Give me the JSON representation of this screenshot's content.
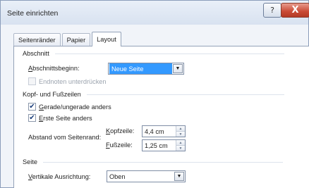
{
  "window": {
    "title": "Seite einrichten",
    "help_glyph": "?",
    "close_glyph": "X"
  },
  "tabs": [
    {
      "label": "Seitenränder",
      "active": false
    },
    {
      "label": "Papier",
      "active": false
    },
    {
      "label": "Layout",
      "active": true
    }
  ],
  "abschnitt": {
    "heading": "Abschnitt",
    "abschnittsbeginn_label": "Abschnittsbeginn:",
    "abschnittsbeginn_value": "Neue Seite",
    "endnoten_label": "Endnoten unterdrücken",
    "endnoten_checked": false
  },
  "kopf_fuss": {
    "heading": "Kopf- und Fußzeilen",
    "gerade_label": "Gerade/ungerade anders",
    "gerade_checked": true,
    "erste_label": "Erste Seite anders",
    "erste_checked": true,
    "abstand_label": "Abstand vom Seitenrand:",
    "kopfzeile_label": "Kopfzeile:",
    "kopfzeile_value": "4,4 cm",
    "fusszeile_label": "Fußzeile:",
    "fusszeile_value": "1,25 cm"
  },
  "seite": {
    "heading": "Seite",
    "ausrichtung_label": "Vertikale Ausrichtung:",
    "ausrichtung_value": "Oben"
  },
  "glyphs": {
    "check": "✔",
    "dropdown_arrow": "▼",
    "spin_up": "▲",
    "spin_down": "▼"
  },
  "colors": {
    "selection": "#3399ff",
    "close_button": "#c94a35",
    "dialog_bg": "#f1f4f9"
  }
}
